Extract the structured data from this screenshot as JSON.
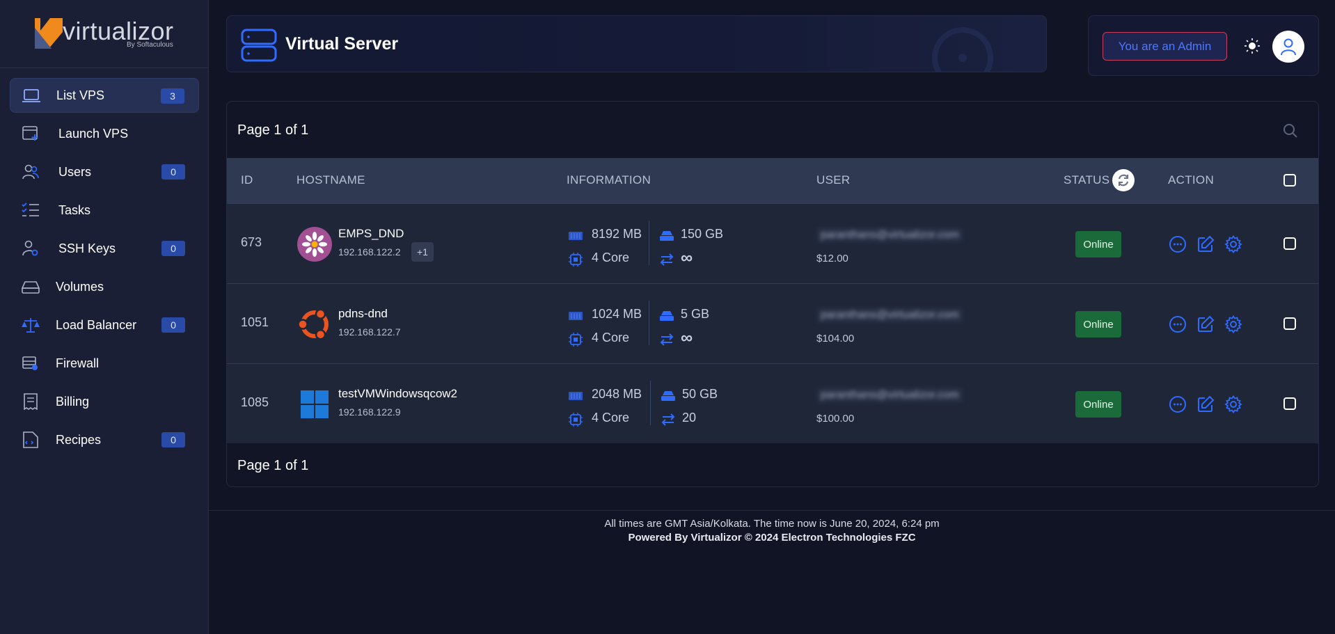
{
  "brand": {
    "name": "virtualizor",
    "sub": "By Softaculous"
  },
  "sidebar": {
    "items": [
      {
        "label": "List VPS",
        "badge": "3",
        "icon": "laptop-icon"
      },
      {
        "label": "Launch VPS",
        "badge": null,
        "icon": "window-plus-icon"
      },
      {
        "label": "Users",
        "badge": "0",
        "icon": "users-icon"
      },
      {
        "label": "Tasks",
        "badge": null,
        "icon": "checklist-icon"
      },
      {
        "label": "SSH Keys",
        "badge": "0",
        "icon": "user-key-icon"
      },
      {
        "label": "Volumes",
        "badge": null,
        "icon": "drive-icon"
      },
      {
        "label": "Load Balancer",
        "badge": "0",
        "icon": "scale-icon"
      },
      {
        "label": "Firewall",
        "badge": null,
        "icon": "firewall-icon"
      },
      {
        "label": "Billing",
        "badge": null,
        "icon": "receipt-icon"
      },
      {
        "label": "Recipes",
        "badge": "0",
        "icon": "code-file-icon"
      }
    ]
  },
  "header": {
    "title": "Virtual Server",
    "admin_label": "You are an Admin"
  },
  "table": {
    "pager_top": "Page 1 of 1",
    "pager_bottom": "Page 1 of 1",
    "columns": {
      "id": "ID",
      "hostname": "HOSTNAME",
      "information": "INFORMATION",
      "user": "USER",
      "status": "STATUS",
      "action": "ACTION"
    },
    "rows": [
      {
        "id": "673",
        "hostname": "EMPS_DND",
        "ip": "192.168.122.2",
        "ip_more": "+1",
        "os": "almalinux",
        "ram": "8192 MB",
        "cpu": "4 Core",
        "disk": "150 GB",
        "bandwidth": "∞",
        "email": "paranthans@virtualizor.com",
        "price": "$12.00",
        "status": "Online"
      },
      {
        "id": "1051",
        "hostname": "pdns-dnd",
        "ip": "192.168.122.7",
        "ip_more": null,
        "os": "ubuntu",
        "ram": "1024 MB",
        "cpu": "4 Core",
        "disk": "5 GB",
        "bandwidth": "∞",
        "email": "paranthans@virtualizor.com",
        "price": "$104.00",
        "status": "Online"
      },
      {
        "id": "1085",
        "hostname": "testVMWindowsqcow2",
        "ip": "192.168.122.9",
        "ip_more": null,
        "os": "windows",
        "ram": "2048 MB",
        "cpu": "4 Core",
        "disk": "50 GB",
        "bandwidth": "20",
        "email": "paranthans@virtualizor.com",
        "price": "$100.00",
        "status": "Online"
      }
    ]
  },
  "footer": {
    "time_note": "All times are GMT Asia/Kolkata. The time now is June 20, 2024, 6:24 pm",
    "powered": "Powered By Virtualizor © 2024 Electron Technologies FZC"
  },
  "colors": {
    "accent": "#2f6bff",
    "online": "#1b6b3a",
    "admin_border": "#c83d5b"
  }
}
